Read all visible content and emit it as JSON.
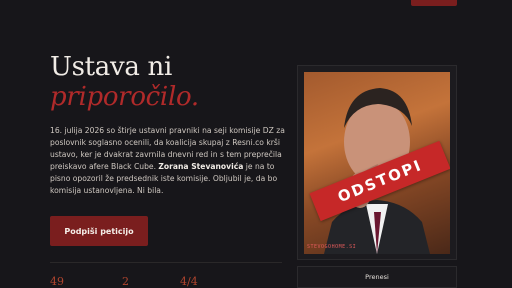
{
  "header": {
    "nav_button_label": ""
  },
  "hero": {
    "title_line1": "Ustava ni",
    "title_line2": "priporočilo.",
    "body_part1": "16. julija 2026 so štirje ustavni pravniki na seji komisije DZ za poslovnik soglasno ocenili, da koalicija skupaj z Resni.co krši ustavo, ker je dvakrat zavrnila dnevni red in s tem preprečila preiskavo afere Black Cube. ",
    "body_bold": "Zorana Stevanovića",
    "body_part2": " je na to pisno opozoril že predsednik iste komisije. Obljubil je, da bo komisija ustanovljena. Ni bila.",
    "cta_label": "Podpiši peticijo"
  },
  "stats": [
    {
      "value": "49"
    },
    {
      "value": "2"
    },
    {
      "value": "4/4"
    }
  ],
  "image": {
    "stamp_text": "ODSTOPI",
    "watermark": "STEVOGOHOME.SI"
  },
  "share": {
    "label": "Prenesi"
  },
  "colors": {
    "accent": "#b02a2a",
    "button": "#7a1e1e",
    "background": "#17161a"
  }
}
